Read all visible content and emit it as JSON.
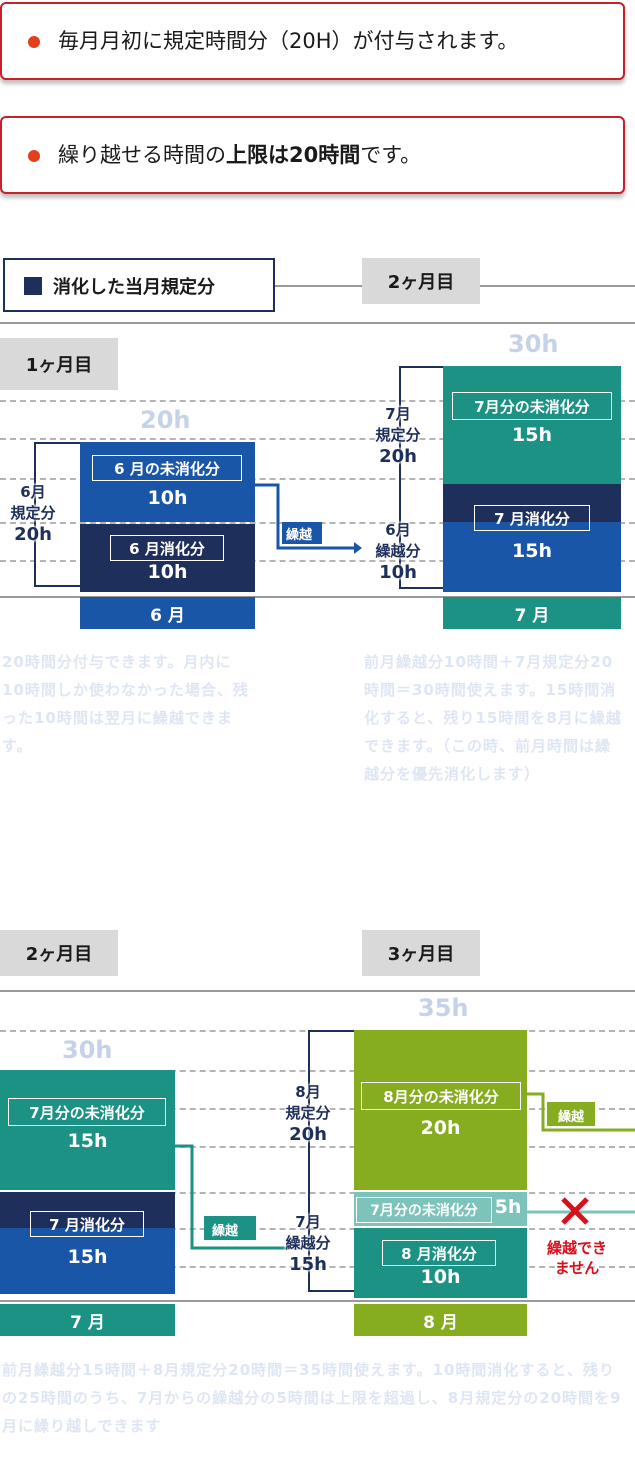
{
  "notices": [
    {
      "text": "毎月月初に規定時間分（20H）が付与されます。"
    },
    {
      "pre": "繰り越せる時間の",
      "bold": "上限は20時間",
      "post": "です。"
    }
  ],
  "legend": {
    "label": "消化した当月規定分"
  },
  "colors": {
    "navy": "#1f2f5c",
    "blue": "#1a56a8",
    "teal": "#1b9283",
    "lime": "#86ad1f",
    "red": "#d8101e"
  },
  "panel1": {
    "tag": "1ヶ月目",
    "total": "20h",
    "unused_label": "6 月の未消化分",
    "unused_hours": "10h",
    "used_label": "6 月消化分",
    "used_hours": "10h",
    "month": "6 月",
    "side_label_1": "6月",
    "side_label_2": "規定分",
    "side_value": "20h",
    "arrow_label": "繰越",
    "note": "20時間分付与できます。月内に10時間しか使わなかった場合、残った10時間は翌月に繰越できます。"
  },
  "panel2": {
    "tag": "2ヶ月目",
    "total": "30h",
    "unused_label": "7月分の未消化分",
    "unused_hours": "15h",
    "used_label": "7 月消化分",
    "used_hours": "15h",
    "month": "7 月",
    "side_a_1": "7月",
    "side_a_2": "規定分",
    "side_a_value": "20h",
    "side_b_1": "6月",
    "side_b_2": "繰越分",
    "side_b_value": "10h",
    "note": "前月繰越分10時間＋7月規定分20時間＝30時間使えます。15時間消化すると、残り15時間を8月に繰越できます。（この時、前月時間は繰越分を優先消化します）"
  },
  "panel3": {
    "tag": "2ヶ月目",
    "total": "30h",
    "unused_label": "7月分の未消化分",
    "unused_hours": "15h",
    "used_label": "7 月消化分",
    "used_hours": "15h",
    "month": "7 月",
    "arrow_label": "繰越"
  },
  "panel4": {
    "tag": "3ヶ月目",
    "total": "35h",
    "unused_label": "8月分の未消化分",
    "unused_hours": "20h",
    "prev_label": "7月分の未消化分",
    "prev_hours": "5h",
    "used_label": "8 月消化分",
    "used_hours": "10h",
    "month": "8 月",
    "side_a_1": "8月",
    "side_a_2": "規定分",
    "side_a_value": "20h",
    "side_b_1": "7月",
    "side_b_2": "繰越分",
    "side_b_value": "15h",
    "arrow_label": "繰越",
    "cannot_1": "繰越でき",
    "cannot_2": "ません"
  },
  "bottom_note": "前月繰越分15時間＋8月規定分20時間＝35時間使えます。10時間消化すると、残りの25時間のうち、7月からの繰越分の5時間は上限を超過し、8月規定分の20時間を9月に繰り越しできます"
}
